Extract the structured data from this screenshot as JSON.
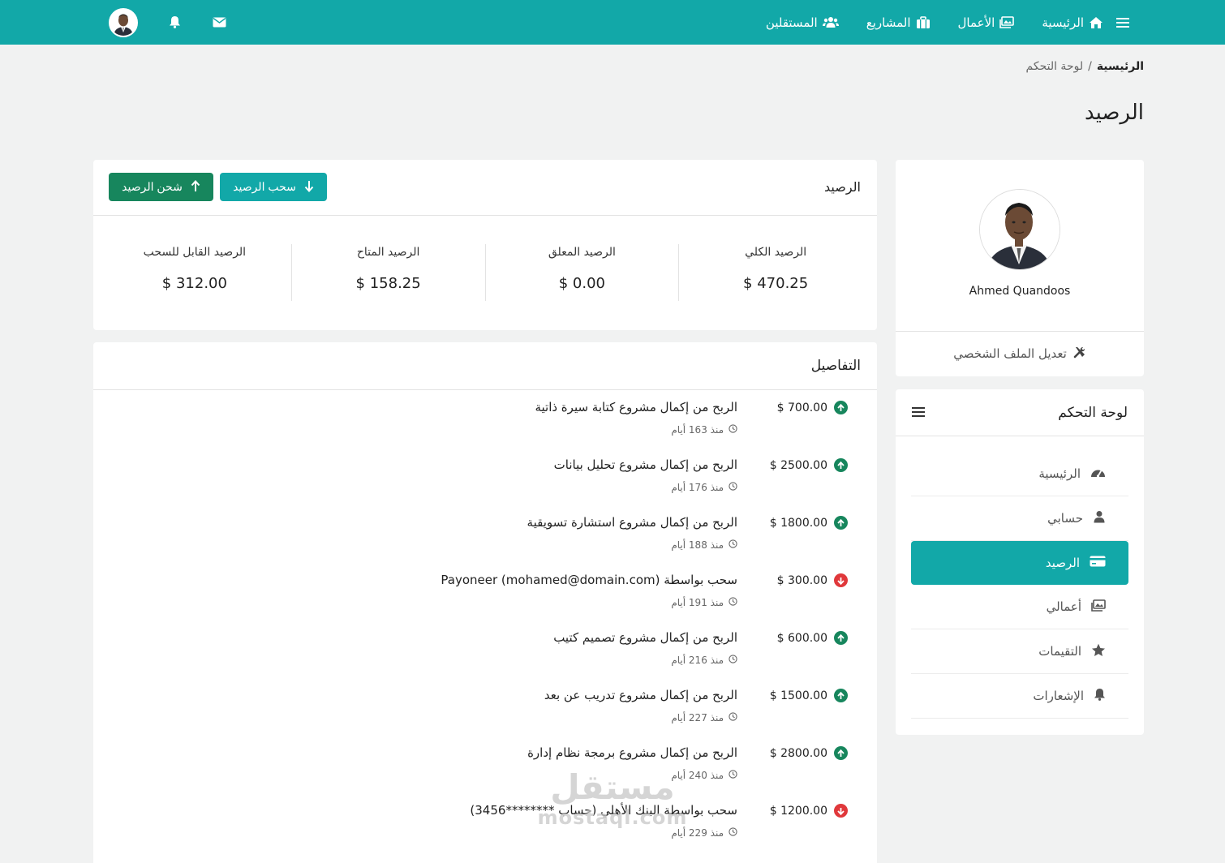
{
  "topbar": {
    "nav": [
      {
        "label": "الرئيسية",
        "icon": "home-icon"
      },
      {
        "label": "الأعمال",
        "icon": "images-icon"
      },
      {
        "label": "المشاريع",
        "icon": "briefcase-icon"
      },
      {
        "label": "المستقلين",
        "icon": "users-icon"
      }
    ],
    "color": "#12a8a8"
  },
  "breadcrumb": {
    "home": "الرئيسية",
    "separator": "/",
    "current": "لوحة التحكم"
  },
  "page_title": "الرصيد",
  "profile": {
    "name": "Ahmed Quandoos",
    "edit_label": "تعديل الملف الشخصي"
  },
  "dashboard": {
    "title": "لوحة التحكم",
    "items": [
      {
        "label": "الرئيسية",
        "icon": "dashboard-icon"
      },
      {
        "label": "حسابي",
        "icon": "user-icon"
      },
      {
        "label": "الرصيد",
        "icon": "credit-card-icon",
        "active": true
      },
      {
        "label": "أعمالي",
        "icon": "images-icon"
      },
      {
        "label": "التقيمات",
        "icon": "star-icon"
      },
      {
        "label": "الإشعارات",
        "icon": "bell-icon"
      }
    ]
  },
  "balance": {
    "title": "الرصيد",
    "withdraw_label": "سحب الرصيد",
    "charge_label": "شحن الرصيد",
    "stats": [
      {
        "label": "الرصيد الكلي",
        "value": "$ 470.25"
      },
      {
        "label": "الرصيد المعلق",
        "value": "$ 0.00"
      },
      {
        "label": "الرصيد المتاح",
        "value": "$ 158.25"
      },
      {
        "label": "الرصيد القابل للسحب",
        "value": "$ 312.00"
      }
    ]
  },
  "details": {
    "title": "التفاصيل",
    "transactions": [
      {
        "type": "in",
        "amount": "$ 700.00",
        "title": "الربح من إكمال مشروع كتابة سيرة ذاتية",
        "time": "منذ 163 أيام"
      },
      {
        "type": "in",
        "amount": "$ 2500.00",
        "title": "الربح من إكمال مشروع تحليل بيانات",
        "time": "منذ 176 أيام"
      },
      {
        "type": "in",
        "amount": "$ 1800.00",
        "title": "الربح من إكمال مشروع استشارة تسويقية",
        "time": "منذ 188 أيام"
      },
      {
        "type": "out",
        "amount": "$ 300.00",
        "title": "سحب بواسطة Payoneer (mohamed@domain.com)",
        "time": "منذ 191 أيام"
      },
      {
        "type": "in",
        "amount": "$ 600.00",
        "title": "الربح من إكمال مشروع تصميم كتيب",
        "time": "منذ 216 أيام"
      },
      {
        "type": "in",
        "amount": "$ 1500.00",
        "title": "الربح من إكمال مشروع تدريب عن بعد",
        "time": "منذ 227 أيام"
      },
      {
        "type": "in",
        "amount": "$ 2800.00",
        "title": "الربح من إكمال مشروع برمجة نظام إدارة",
        "time": "منذ 240 أيام"
      },
      {
        "type": "out",
        "amount": "$ 1200.00",
        "title": "سحب بواسطة البنك الأهلي (حساب ********3456)",
        "time": "منذ 229 أيام"
      }
    ]
  },
  "watermark": {
    "arabic": "مستقل",
    "latin": "mostaql.com"
  }
}
